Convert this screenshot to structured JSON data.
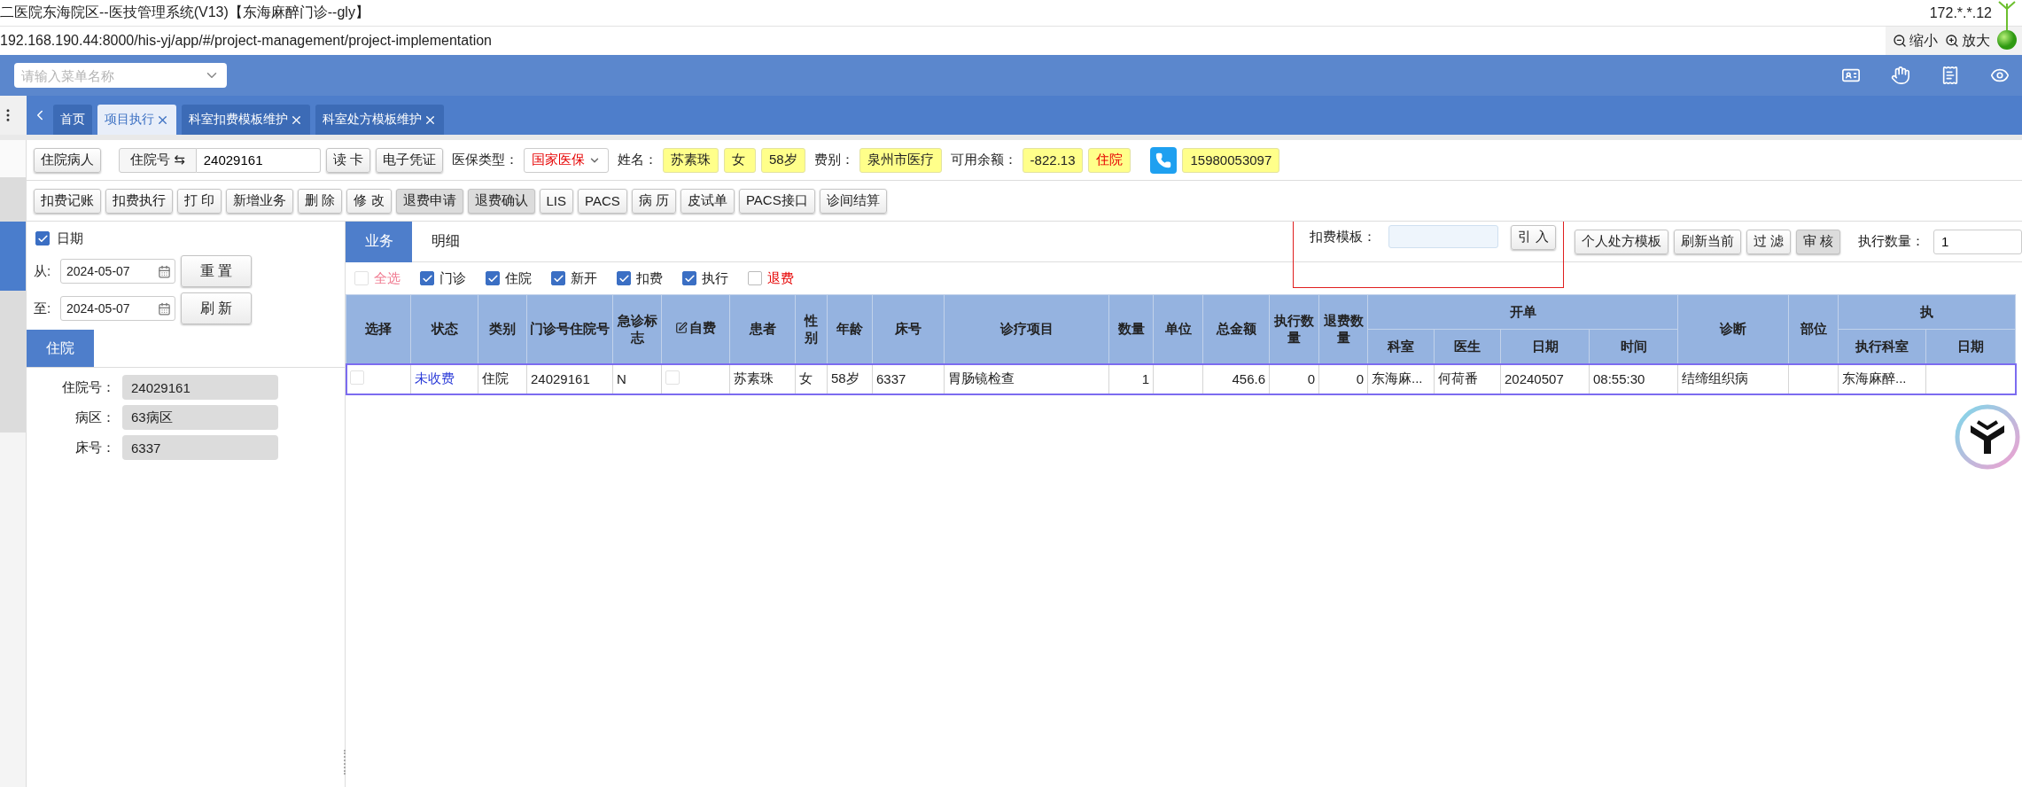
{
  "window": {
    "title": "二医院东海院区--医技管理系统(V13)【东海麻醉门诊--gly】",
    "ip": "172.*.*.12",
    "url": "192.168.190.44:8000/his-yj/app/#/project-management/project-implementation"
  },
  "zoom_controls": [
    {
      "kind": "out",
      "label": "缩小"
    },
    {
      "kind": "in",
      "label": "放大"
    }
  ],
  "menu_search": {
    "placeholder": "请输入菜单名称"
  },
  "header_icons": [
    {
      "kind": "card"
    },
    {
      "kind": "hand"
    },
    {
      "kind": "receipt"
    },
    {
      "kind": "eye"
    }
  ],
  "tabs": [
    {
      "label": "首页",
      "selected": false,
      "closable": false
    },
    {
      "label": "项目执行",
      "selected": true,
      "closable": true
    },
    {
      "label": "科室扣费模板维护",
      "selected": false,
      "closable": true
    },
    {
      "label": "科室处方模板维护",
      "selected": false,
      "closable": true
    }
  ],
  "patient_bar": [
    {
      "kind": "button",
      "text": "住院病人"
    },
    {
      "kind": "id_field",
      "label": "住院号 ⇆",
      "value": "24029161"
    },
    {
      "kind": "button",
      "text": "读 卡"
    },
    {
      "kind": "button",
      "text": "电子凭证"
    },
    {
      "kind": "label",
      "text": "医保类型："
    },
    {
      "kind": "select",
      "text": "国家医保"
    },
    {
      "kind": "label",
      "text": "姓名："
    },
    {
      "kind": "tag",
      "text": "苏素珠",
      "alert": false
    },
    {
      "kind": "tag",
      "text": "女",
      "alert": false
    },
    {
      "kind": "tag",
      "text": "58岁",
      "alert": false
    },
    {
      "kind": "label",
      "text": "费别："
    },
    {
      "kind": "tag",
      "text": "泉州市医疗",
      "alert": false
    },
    {
      "kind": "label",
      "text": "可用余额："
    },
    {
      "kind": "tag",
      "text": "-822.13",
      "alert": false
    },
    {
      "kind": "tag",
      "text": "住院",
      "alert": true
    },
    {
      "kind": "phone"
    },
    {
      "kind": "tag",
      "text": "15980053097",
      "alert": false
    }
  ],
  "toolbar": [
    {
      "text": "扣费记账",
      "pressed": false
    },
    {
      "text": "扣费执行",
      "pressed": false
    },
    {
      "text": "打 印",
      "pressed": false
    },
    {
      "text": "新增业务",
      "pressed": false
    },
    {
      "text": "删 除",
      "pressed": false
    },
    {
      "text": "修 改",
      "pressed": false
    },
    {
      "text": "退费申请",
      "pressed": true
    },
    {
      "text": "退费确认",
      "pressed": true
    },
    {
      "text": "LIS",
      "pressed": false
    },
    {
      "text": "PACS",
      "pressed": false
    },
    {
      "text": "病 历",
      "pressed": false
    },
    {
      "text": "皮试单",
      "pressed": false
    },
    {
      "text": "PACS接口",
      "pressed": false
    },
    {
      "text": "诊间结算",
      "pressed": false
    }
  ],
  "left_panel": {
    "date_filter": {
      "label": "日期",
      "checked": true
    },
    "from": {
      "label": "从:",
      "value": "2024-05-07"
    },
    "to": {
      "label": "至:",
      "value": "2024-05-07"
    },
    "buttons": [
      "重 置",
      "刷 新"
    ],
    "tab": "住院",
    "fields": [
      {
        "label": "住院号：",
        "value": "24029161"
      },
      {
        "label": "病区：",
        "value": "63病区"
      },
      {
        "label": "床号：",
        "value": "6337"
      }
    ]
  },
  "main": {
    "tabs": [
      {
        "label": "业务",
        "selected": true
      },
      {
        "label": "明细",
        "selected": false
      }
    ],
    "template_tools": {
      "label": "扣费模板：",
      "highlighted": true,
      "button": "引 入"
    },
    "buttons": [
      {
        "text": "个人处方模板",
        "pressed": false
      },
      {
        "text": "刷新当前",
        "pressed": false
      },
      {
        "text": "过 滤",
        "pressed": false
      },
      {
        "text": "审 核",
        "pressed": true
      }
    ],
    "exec_qty": {
      "label": "执行数量：",
      "value": "1"
    },
    "filters": [
      {
        "label": "全选",
        "checked": false,
        "disabled": true,
        "alert": false
      },
      {
        "label": "门诊",
        "checked": true,
        "disabled": false,
        "alert": false
      },
      {
        "label": "住院",
        "checked": true,
        "disabled": false,
        "alert": false
      },
      {
        "label": "新开",
        "checked": true,
        "disabled": false,
        "alert": false
      },
      {
        "label": "扣费",
        "checked": true,
        "disabled": false,
        "alert": false
      },
      {
        "label": "执行",
        "checked": true,
        "disabled": false,
        "alert": false
      },
      {
        "label": "退费",
        "checked": false,
        "disabled": false,
        "alert": true
      }
    ],
    "table": {
      "header_rows": [
        [
          {
            "label": "选择",
            "rowspan": 2
          },
          {
            "label": "状态",
            "rowspan": 2
          },
          {
            "label": "类别",
            "rowspan": 2
          },
          {
            "label": "门诊号住院号",
            "rowspan": 2
          },
          {
            "label": "急诊标志",
            "rowspan": 2
          },
          {
            "label": "自费",
            "rowspan": 2,
            "editable": true
          },
          {
            "label": "患者",
            "rowspan": 2
          },
          {
            "label": "性别",
            "rowspan": 2
          },
          {
            "label": "年龄",
            "rowspan": 2
          },
          {
            "label": "床号",
            "rowspan": 2
          },
          {
            "label": "诊疗项目",
            "rowspan": 2
          },
          {
            "label": "数量",
            "rowspan": 2
          },
          {
            "label": "单位",
            "rowspan": 2
          },
          {
            "label": "总金额",
            "rowspan": 2
          },
          {
            "label": "执行数量",
            "rowspan": 2
          },
          {
            "label": "退费数量",
            "rowspan": 2
          },
          {
            "label": "开单",
            "colspan": 4
          },
          {
            "label": "诊断",
            "rowspan": 2
          },
          {
            "label": "部位",
            "rowspan": 2
          },
          {
            "label": "执",
            "colspan": 2
          }
        ],
        [
          {
            "label": "科室"
          },
          {
            "label": "医生"
          },
          {
            "label": "日期"
          },
          {
            "label": "时间"
          },
          {
            "label": "执行科室"
          },
          {
            "label": "日期"
          }
        ]
      ],
      "rows": [
        {
          "selected": true,
          "cells": [
            {
              "kind": "check",
              "checked": false
            },
            {
              "kind": "link",
              "text": "未收费"
            },
            {
              "kind": "text",
              "text": "住院"
            },
            {
              "kind": "text",
              "text": "24029161"
            },
            {
              "kind": "text",
              "text": "N"
            },
            {
              "kind": "check",
              "checked": false
            },
            {
              "kind": "text",
              "text": "苏素珠"
            },
            {
              "kind": "text",
              "text": "女"
            },
            {
              "kind": "text",
              "text": "58岁"
            },
            {
              "kind": "text",
              "text": "6337"
            },
            {
              "kind": "text",
              "text": "胃肠镜检查"
            },
            {
              "kind": "number",
              "text": "1"
            },
            {
              "kind": "empty"
            },
            {
              "kind": "number",
              "text": "456.6"
            },
            {
              "kind": "number",
              "text": "0"
            },
            {
              "kind": "number",
              "text": "0"
            },
            {
              "kind": "text",
              "text": "东海麻..."
            },
            {
              "kind": "text",
              "text": "何荷番"
            },
            {
              "kind": "text",
              "text": "20240507"
            },
            {
              "kind": "text",
              "text": "08:55:30"
            },
            {
              "kind": "text",
              "text": "结缔组织病"
            },
            {
              "kind": "empty"
            },
            {
              "kind": "text",
              "text": "东海麻醉..."
            },
            {
              "kind": "empty"
            }
          ]
        }
      ]
    }
  }
}
